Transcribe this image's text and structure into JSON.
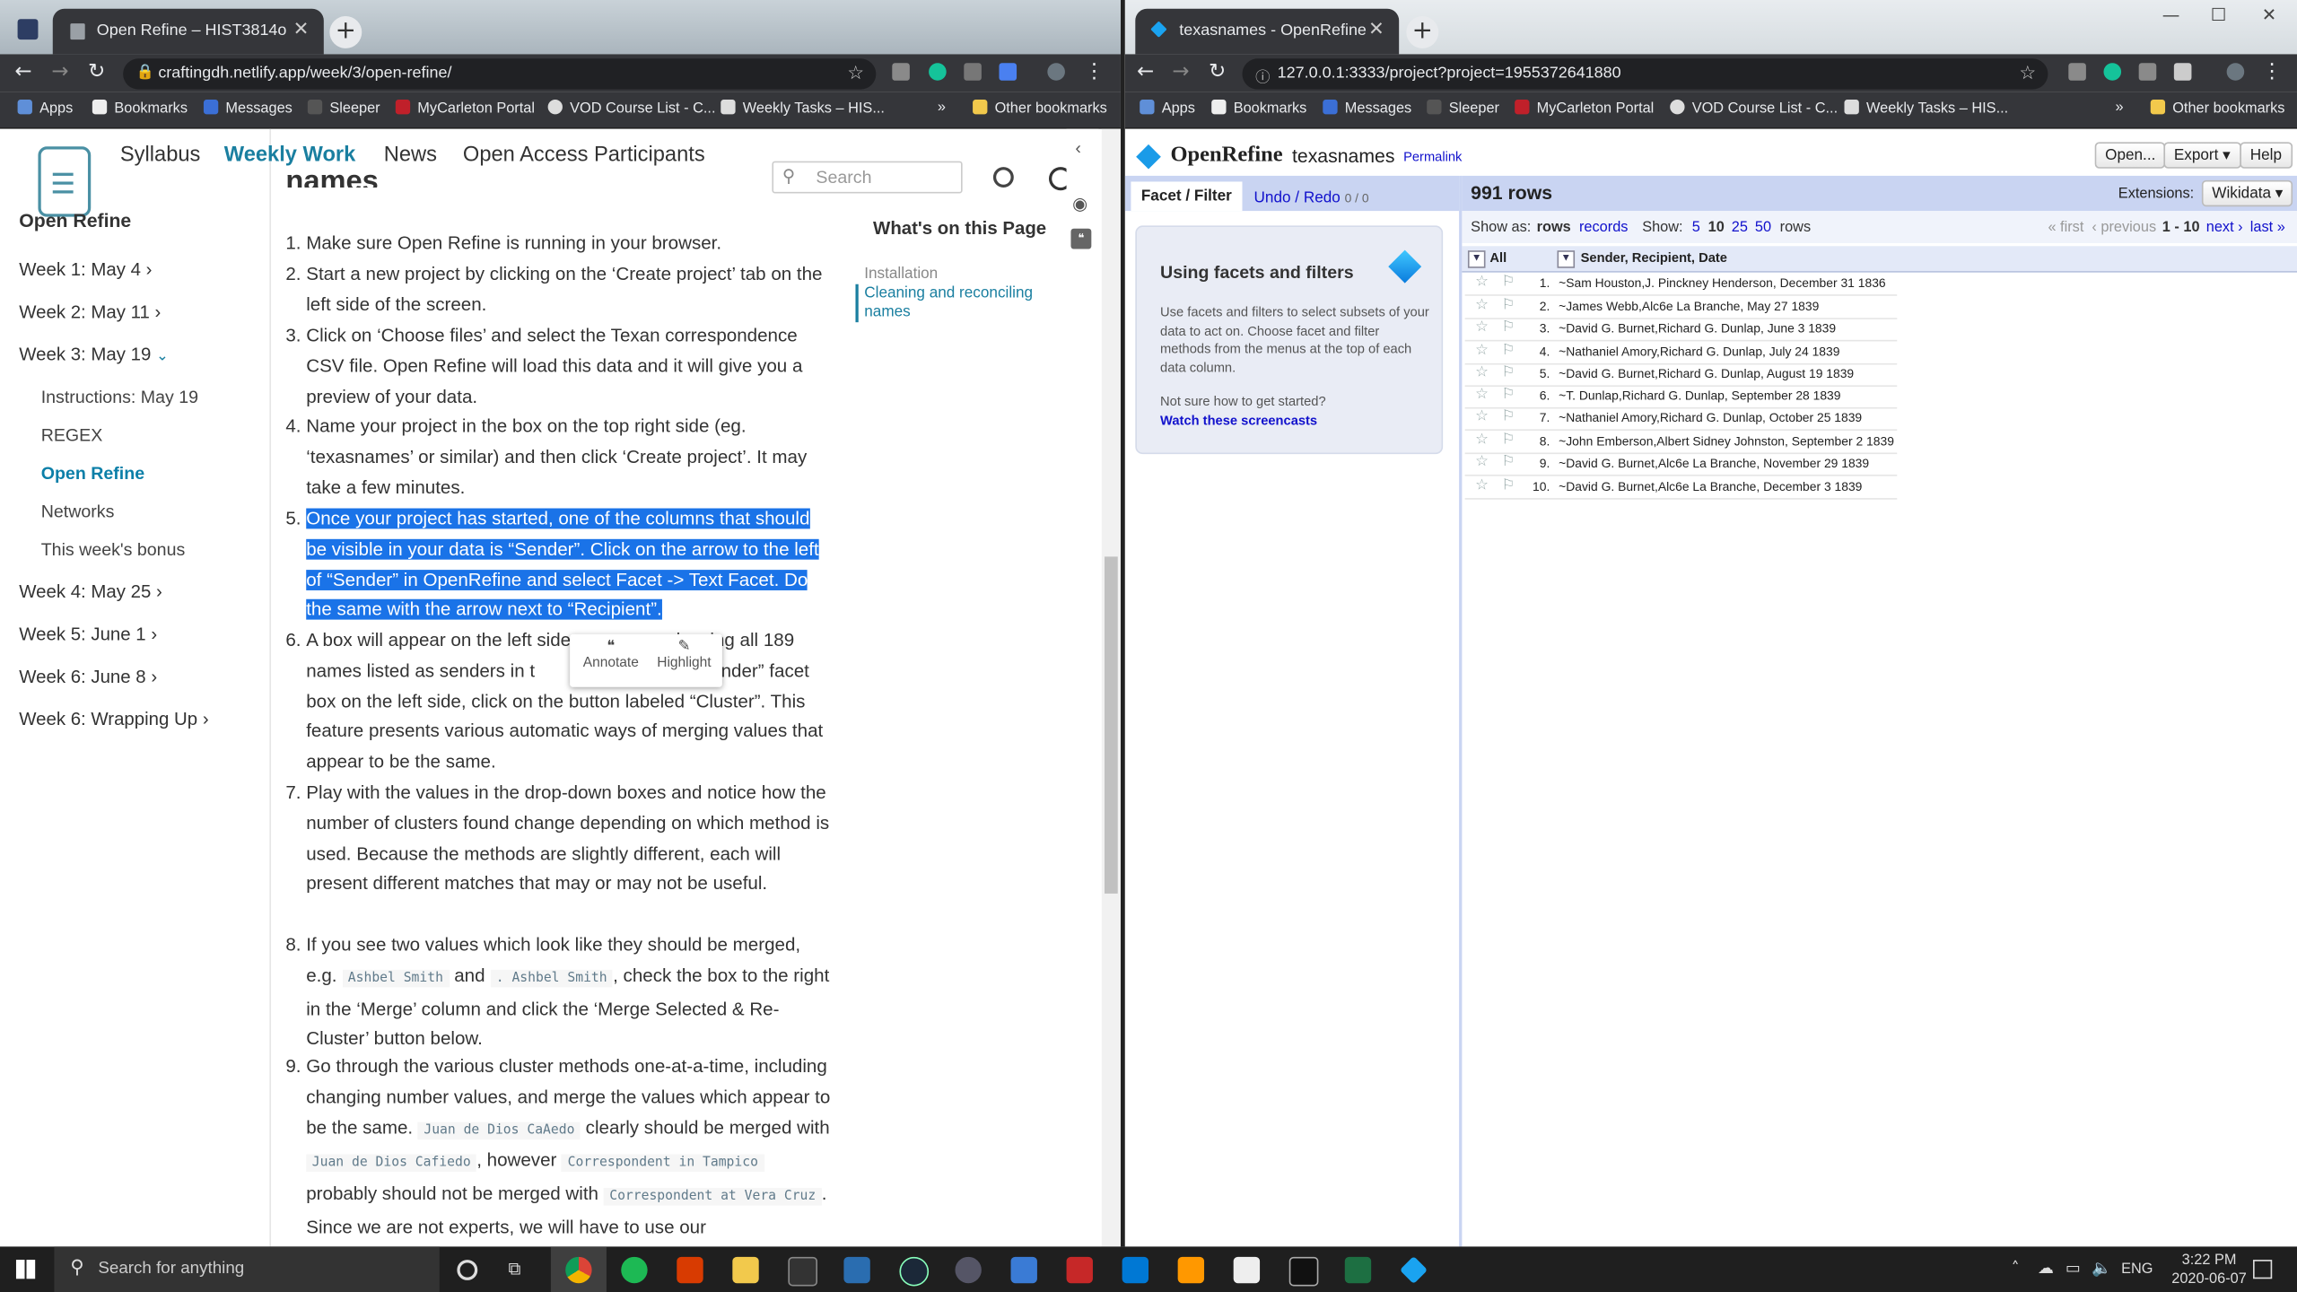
{
  "left_browser": {
    "tab_title": "Open Refine – HIST3814o",
    "url": "craftingdh.netlify.app/week/3/open-refine/",
    "bookmarks": [
      "Apps",
      "Bookmarks",
      "Messages",
      "Sleeper",
      "MyCarleton Portal",
      "VOD Course List - C...",
      "Weekly Tasks – HIS..."
    ],
    "bookmarks_more": "»",
    "other_bookmarks": "Other bookmarks"
  },
  "site": {
    "topnav": [
      "Syllabus",
      "Weekly Work",
      "News",
      "Open Access Participants"
    ],
    "search_placeholder": "Search",
    "page_heading_partial": "names",
    "sidebar_title": "Open Refine",
    "weeks": [
      "Week 1: May 4",
      "Week 2: May 11",
      "Week 3: May 19",
      "Week 4: May 25",
      "Week 5: June 1",
      "Week 6: June 8",
      "Week 6: Wrapping Up"
    ],
    "sub_items": [
      "Instructions: May 19",
      "REGEX",
      "Open Refine",
      "Networks",
      "This week's bonus"
    ],
    "toc_title": "What's on this Page",
    "toc_items": [
      "Installation",
      "Cleaning and reconciling names"
    ],
    "annotate_label": "Annotate",
    "highlight_label": "Highlight",
    "steps": [
      {
        "n": "1.",
        "text": "Make sure Open Refine is running in your browser."
      },
      {
        "n": "2.",
        "text": "Start a new project by clicking on the ‘Create project’ tab on the left side of the screen."
      },
      {
        "n": "3.",
        "text": "Click on ‘Choose files’ and select the Texan correspondence CSV file. Open Refine will load this data and it will give you a preview of your data."
      },
      {
        "n": "4.",
        "text": "Name your project in the box on the top right side (eg. ‘texasnames’ or similar) and then click ‘Create project’. It may take a few minutes."
      },
      {
        "n": "5.",
        "text": "Once your project has started, one of the columns that should be visible in your data is “Sender”. Click on the arrow to the left of “Sender” in OpenRefine and select Facet -> Text Facet. Do the same with the arrow next to “Recipient”."
      },
      {
        "n": "6.",
        "text_a": "A box will appear on the left side",
        "text_b": "howing all 189 names listed as senders in t",
        "text_c": "Within the “Sender” facet box on the left side, click on the button labeled “Cluster”. This feature presents various automatic ways of merging values that appear to be the same."
      },
      {
        "n": "7.",
        "text": "Play with the values in the drop-down boxes and notice how the number of clusters found change depending on which method is used. Because the methods are slightly different, each will present different matches that may or may not be useful."
      },
      {
        "n": "8.",
        "t1": "If you see two values which look like they should be merged, e.g.",
        "c1": "Ashbel Smith",
        "t2": "and",
        "c2": ". Ashbel Smith",
        "t3": ", check the box to the right in the ‘Merge’ column and click the ‘Merge Selected & Re-Cluster’ button below."
      },
      {
        "n": "9.",
        "t1": "Go through the various cluster methods one-at-a-time, including changing number values, and merge the values which appear to be the same.",
        "c1": "Juan de Dios CaAedo",
        "t2": "clearly should be merged with",
        "c2": "Juan de Dios Cafiedo",
        "t3": ", however",
        "c3": "Correspondent in Tampico",
        "t4": "probably should not be merged with",
        "c4": "Correspondent at Vera Cruz",
        "t5": ". Since we are not experts, we will have to use our"
      }
    ]
  },
  "right_browser": {
    "tab_title": "texasnames - OpenRefine",
    "url": "127.0.0.1:3333/project?project=1955372641880",
    "bookmarks": [
      "Apps",
      "Bookmarks",
      "Messages",
      "Sleeper",
      "MyCarleton Portal",
      "VOD Course List - C...",
      "Weekly Tasks – HIS..."
    ],
    "bookmarks_more": "»",
    "other_bookmarks": "Other bookmarks"
  },
  "openrefine": {
    "app_name": "OpenRefine",
    "project_name": "texasnames",
    "permalink": "Permalink",
    "buttons": {
      "open": "Open...",
      "export": "Export ▾",
      "help": "Help"
    },
    "tab_facet": "Facet / Filter",
    "tab_undo": "Undo / Redo",
    "undo_count": "0 / 0",
    "facet_heading": "Using facets and filters",
    "facet_body": "Use facets and filters to select subsets of your data to act on. Choose facet and filter methods from the menus at the top of each data column.",
    "facet_help": "Not sure how to get started?",
    "facet_link": "Watch these screencasts",
    "row_count": "991 rows",
    "extensions_label": "Extensions:",
    "extensions_value": "Wikidata ▾",
    "show_as": "Show as:",
    "show_rows": "rows",
    "show_records": "records",
    "show_label": "Show:",
    "page_sizes": [
      "5",
      "10",
      "25",
      "50"
    ],
    "rows_word": "rows",
    "pager": {
      "first": "« first",
      "previous": "‹ previous",
      "range": "1 - 10",
      "next": "next ›",
      "last": "last »"
    },
    "col_all": "All",
    "col_header": "Sender, Recipient, Date",
    "rows": [
      {
        "n": "1.",
        "v": "~Sam Houston,J. Pinckney Henderson, December 31 1836"
      },
      {
        "n": "2.",
        "v": "~James Webb,Alc6e La Branche, May 27 1839"
      },
      {
        "n": "3.",
        "v": "~David G. Burnet,Richard G. Dunlap, June 3 1839"
      },
      {
        "n": "4.",
        "v": "~Nathaniel Amory,Richard G. Dunlap, July 24 1839"
      },
      {
        "n": "5.",
        "v": "~David G. Burnet,Richard G. Dunlap, August 19 1839"
      },
      {
        "n": "6.",
        "v": "~T. Dunlap,Richard G. Dunlap, September 28 1839"
      },
      {
        "n": "7.",
        "v": "~Nathaniel Amory,Richard G. Dunlap, October 25 1839"
      },
      {
        "n": "8.",
        "v": "~John Emberson,Albert Sidney Johnston, September 2 1839"
      },
      {
        "n": "9.",
        "v": "~David G. Burnet,Alc6e La Branche, November 29 1839"
      },
      {
        "n": "10.",
        "v": "~David G. Burnet,Alc6e La Branche, December 3 1839"
      }
    ]
  },
  "taskbar": {
    "search_placeholder": "Search for anything",
    "language": "ENG",
    "time": "3:22 PM",
    "date": "2020-06-07"
  }
}
